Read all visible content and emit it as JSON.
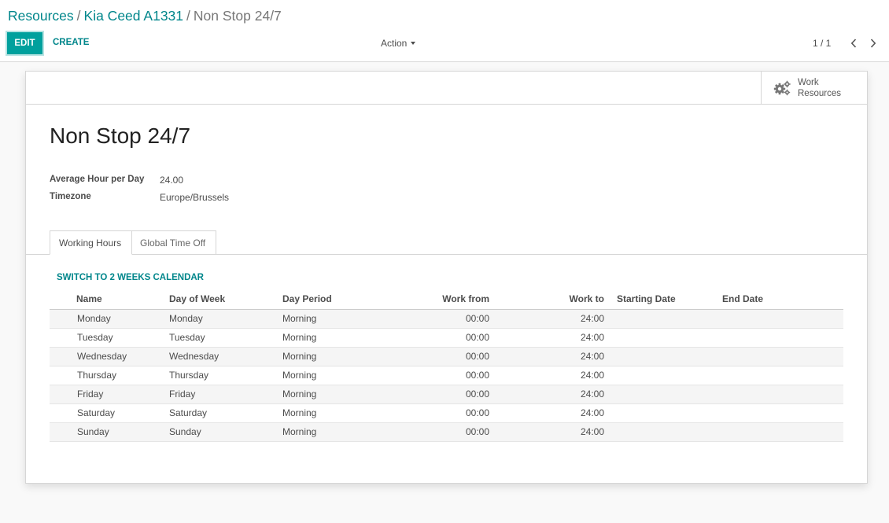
{
  "breadcrumb": {
    "items": [
      "Resources",
      "Kia Ceed A1331"
    ],
    "separator": "/",
    "current": "Non Stop 24/7"
  },
  "toolbar": {
    "edit_label": "EDIT",
    "create_label": "CREATE",
    "action_label": "Action",
    "pager": "1 / 1"
  },
  "smart_button": {
    "icon": "gears-icon",
    "line1": "Work",
    "line2": "Resources"
  },
  "record": {
    "title": "Non Stop 24/7",
    "fields": [
      {
        "label": "Average Hour per Day",
        "value": "24.00"
      },
      {
        "label": "Timezone",
        "value": "Europe/Brussels"
      }
    ]
  },
  "tabs": [
    {
      "label": "Working Hours",
      "active": true
    },
    {
      "label": "Global Time Off",
      "active": false
    }
  ],
  "switch_calendar_label": "SWITCH TO 2 WEEKS CALENDAR",
  "table": {
    "headers": [
      "Name",
      "Day of Week",
      "Day Period",
      "Work from",
      "Work to",
      "Starting Date",
      "End Date"
    ],
    "rows": [
      [
        "Monday",
        "Monday",
        "Morning",
        "00:00",
        "24:00",
        "",
        ""
      ],
      [
        "Tuesday",
        "Tuesday",
        "Morning",
        "00:00",
        "24:00",
        "",
        ""
      ],
      [
        "Wednesday",
        "Wednesday",
        "Morning",
        "00:00",
        "24:00",
        "",
        ""
      ],
      [
        "Thursday",
        "Thursday",
        "Morning",
        "00:00",
        "24:00",
        "",
        ""
      ],
      [
        "Friday",
        "Friday",
        "Morning",
        "00:00",
        "24:00",
        "",
        ""
      ],
      [
        "Saturday",
        "Saturday",
        "Morning",
        "00:00",
        "24:00",
        "",
        ""
      ],
      [
        "Sunday",
        "Sunday",
        "Morning",
        "00:00",
        "24:00",
        "",
        ""
      ]
    ]
  },
  "colors": {
    "primary": "#00a09d",
    "link": "#00868b",
    "text": "#4c4c4c"
  }
}
